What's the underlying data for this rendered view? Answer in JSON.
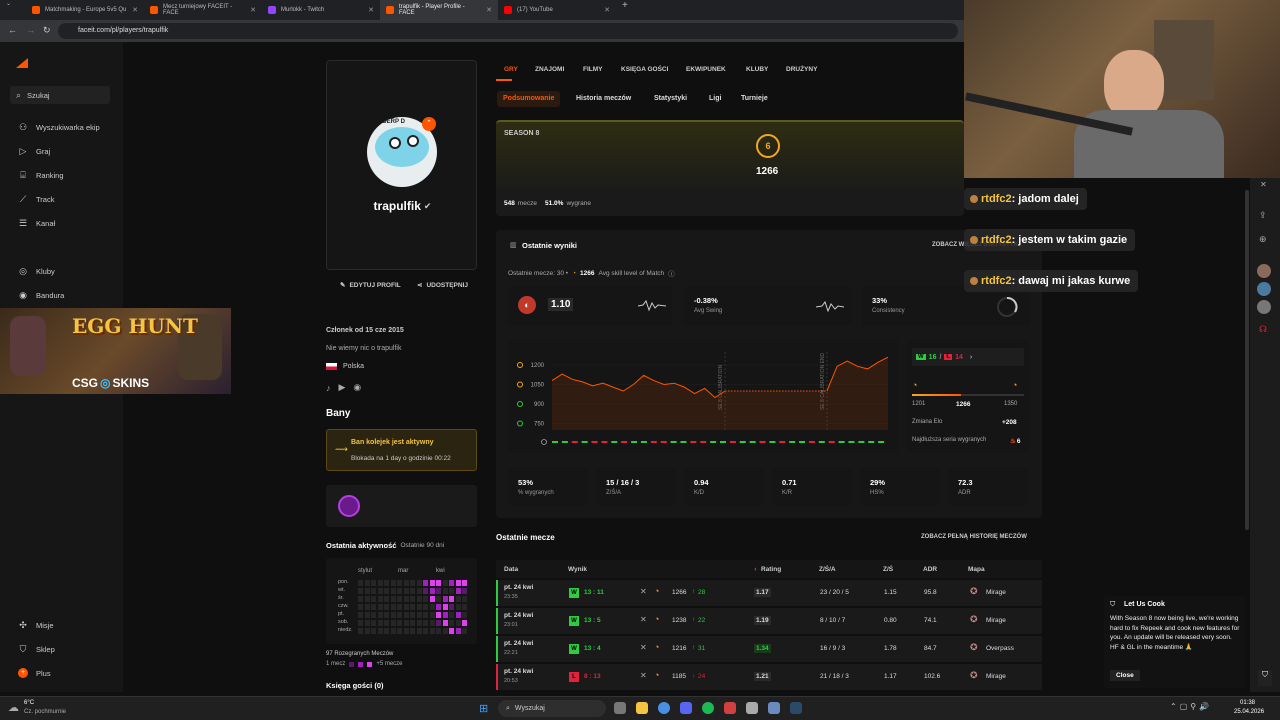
{
  "browser": {
    "tabs": [
      {
        "title": "Matchmaking - Europe 5v5 Qu",
        "color": "#ff5500"
      },
      {
        "title": "Mecz turniejowy FACEIT - FACE",
        "color": "#ff5500"
      },
      {
        "title": "Murlokk - Twitch",
        "color": "#9146ff"
      },
      {
        "title": "trapulfik - Player Profile - FACE",
        "color": "#ff5500"
      },
      {
        "title": "(17) YouTube",
        "color": "#ff0000"
      }
    ],
    "url": "faceit.com/pl/players/trapulfik"
  },
  "sidebar": {
    "search": "Szukaj",
    "items": [
      "Wyszukiwarka ekip",
      "Graj",
      "Ranking",
      "Track",
      "Kanał"
    ],
    "clubs": [
      "Kluby",
      "Bandura"
    ],
    "ad": {
      "title": "EGG HUNT",
      "brand": "CSG",
      "brand2": "SKINS"
    },
    "bottom": [
      "Misje",
      "Sklep",
      "Plus"
    ]
  },
  "profile": {
    "name": "trapulfik",
    "avatar_text": "PA DERP D",
    "edit": "EDYTUJ PROFIL",
    "share": "UDOSTĘPNIJ",
    "member_since": "Członek od 15 cze 2015",
    "about": "Nie wiemy nic o trapulfik",
    "country": "Polska",
    "bans_title": "Bany",
    "ban_active": "Ban kolejek jest aktywny",
    "ban_detail": "Blokada na 1 day o godzinie 00:22",
    "activity_title": "Ostatnia aktywność",
    "activity_range": "Ostatnie 90 dni",
    "months": [
      "stylut",
      "mar",
      "kwi"
    ],
    "days": [
      "pon.",
      "wt.",
      "śr.",
      "czw.",
      "pt.",
      "sob.",
      "niedz."
    ],
    "matches_played": "97 Rozegranych Meczów",
    "legend_min": "1 mecz",
    "legend_max": "+5 mecze",
    "guestbook": "Księga gości (0)"
  },
  "nav": {
    "top": [
      "GRY",
      "ZNAJOMI",
      "FILMY",
      "KSIĘGA GOŚCI",
      "EKWIPUNEK",
      "KLUBY",
      "DRUŻYNY"
    ],
    "sub": [
      "Podsumowanie",
      "Historia meczów",
      "Statystyki",
      "Ligi",
      "Turnieje"
    ]
  },
  "season": {
    "label": "SEASON 8",
    "level": "6",
    "elo": "1266",
    "matches": "548",
    "matches_l": "mecze",
    "win": "51.0%",
    "win_l": "wygrane"
  },
  "recent": {
    "title": "Ostatnie wyniki",
    "see_more": "ZOBACZ WIĘCEJ STATYSTYK",
    "subtitle": "Ostatnie mecze: 30 •",
    "avg_elo": "1266",
    "avg_label": "Avg skill level of Match",
    "rating": "1.10",
    "swing": "-0.38%",
    "swing_l": "Avg Swing",
    "consistency": "33%",
    "consistency_l": "Consistency",
    "wins": "16",
    "losses": "14",
    "elo_min": "1201",
    "elo_cur": "1266",
    "elo_max": "1350",
    "elo_change_l": "Zmiana Elo",
    "elo_change": "+208",
    "streak_l": "Najdłuższa seria wygranych",
    "streak": "6",
    "stats": [
      {
        "v": "53%",
        "l": "% wygranych"
      },
      {
        "v": "15 / 16 / 3",
        "l": "Z/Ś/A"
      },
      {
        "v": "0.94",
        "l": "K/D"
      },
      {
        "v": "0.71",
        "l": "K/R"
      },
      {
        "v": "29%",
        "l": "HS%"
      },
      {
        "v": "72.3",
        "l": "ADR"
      }
    ],
    "chart_labels": [
      "SE 8 CALIBRATION",
      "SE 8 CALIBRATION END"
    ]
  },
  "chart_data": {
    "type": "line",
    "y_ticks": [
      1200,
      1050,
      900,
      750
    ],
    "ylim": [
      700,
      1300
    ],
    "values": [
      1080,
      1130,
      1090,
      1070,
      1040,
      1060,
      1030,
      1000,
      1050,
      1120,
      1080,
      1050,
      1060,
      1030,
      980,
      1020,
      950,
      1000,
      1000,
      1000,
      1000,
      1000,
      1000,
      1000,
      1000,
      1000,
      1000,
      1000,
      1190,
      1230,
      1190,
      1170,
      1220,
      1260
    ],
    "results": [
      "W",
      "W",
      "L",
      "W",
      "L",
      "L",
      "W",
      "L",
      "W",
      "W",
      "L",
      "L",
      "W",
      "W",
      "L",
      "L",
      "W",
      "W",
      "L",
      "W",
      "W",
      "L",
      "W",
      "L",
      "W",
      "W",
      "L",
      "W",
      "L",
      "W",
      "W",
      "W",
      "W",
      "W"
    ],
    "labels": [
      "SE 8 CALIBRATION",
      "SE 8 CALIBRATION END"
    ]
  },
  "matches": {
    "title": "Ostatnie mecze",
    "see_all": "ZOBACZ PEŁNĄ HISTORIĘ MECZÓW",
    "headers": [
      "Data",
      "Wynik",
      "Rating",
      "Z/Ś/A",
      "Z/Ś",
      "ADR",
      "Mapa"
    ],
    "rows": [
      {
        "date": "pt. 24 kwi",
        "time": "23:35",
        "res": "W",
        "score": "13 : 11",
        "elo": "1266",
        "delta": "28",
        "rating": "1.17",
        "ksa": "23 / 20 / 5",
        "kd": "1.15",
        "adr": "95.8",
        "map": "Mirage"
      },
      {
        "date": "pt. 24 kwi",
        "time": "23:01",
        "res": "W",
        "score": "13 : 5",
        "elo": "1238",
        "delta": "22",
        "rating": "1.19",
        "ksa": "8 / 10 / 7",
        "kd": "0.80",
        "adr": "74.1",
        "map": "Mirage"
      },
      {
        "date": "pt. 24 kwi",
        "time": "22:21",
        "res": "W",
        "score": "13 : 4",
        "elo": "1216",
        "delta": "31",
        "rating": "1.34",
        "ksa": "16 / 9 / 3",
        "kd": "1.78",
        "adr": "84.7",
        "map": "Overpass"
      },
      {
        "date": "pt. 24 kwi",
        "time": "20:53",
        "res": "L",
        "score": "8 : 13",
        "elo": "1185",
        "delta": "24",
        "rating": "1.21",
        "ksa": "21 / 18 / 3",
        "kd": "1.17",
        "adr": "102.6",
        "map": "Mirage"
      }
    ]
  },
  "stream_chat": [
    {
      "user": "rtdfc2",
      "msg": "jadom dalej"
    },
    {
      "user": "rtdfc2",
      "msg": "jestem w takim gazie"
    },
    {
      "user": "rtdfc2",
      "msg": "dawaj mi jakas kurwe"
    }
  ],
  "toast": {
    "title": "Let Us Cook",
    "body": "With Season 8 now being live, we're working hard to fix Repeek and cook new features for you. An update will be released very soon. HF & GL in the meantime 🙏",
    "close": "Close"
  },
  "taskbar": {
    "temp": "6°C",
    "weather": "Cz. pochmurnie",
    "search": "Wyszukaj",
    "time": "01:38",
    "date": "25.04.2026"
  }
}
